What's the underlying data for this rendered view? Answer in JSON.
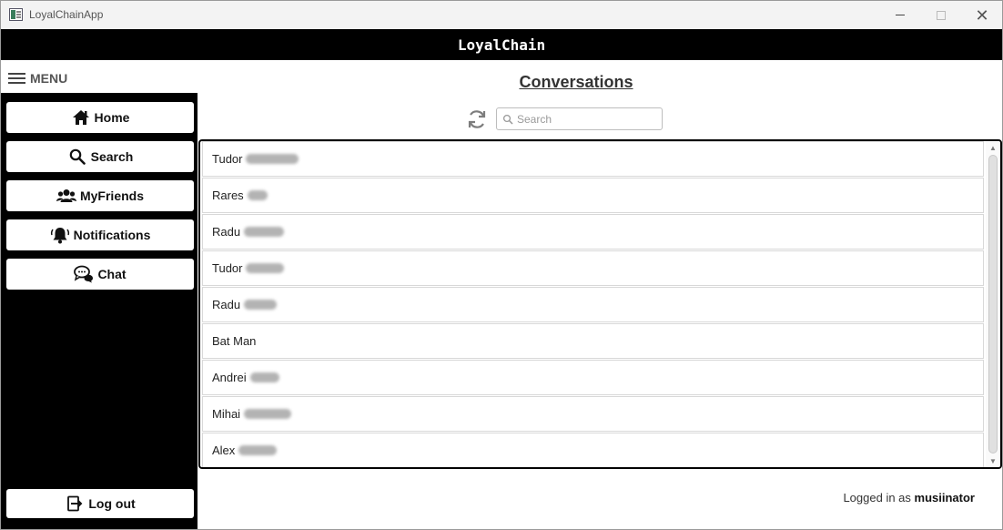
{
  "window": {
    "title": "LoyalChainApp"
  },
  "header": {
    "title": "LoyalChain"
  },
  "menu": {
    "label": "MENU"
  },
  "sidebar": {
    "items": [
      {
        "label": "Home",
        "icon": "home-icon"
      },
      {
        "label": "Search",
        "icon": "search-icon"
      },
      {
        "label": "MyFriends",
        "icon": "friends-icon"
      },
      {
        "label": "Notifications",
        "icon": "bell-icon"
      },
      {
        "label": "Chat",
        "icon": "chat-icon"
      }
    ],
    "logout_label": "Log out"
  },
  "main": {
    "title": "Conversations",
    "search_placeholder": "Search",
    "conversations": [
      {
        "first_name": "Tudor"
      },
      {
        "first_name": "Rares"
      },
      {
        "first_name": "Radu"
      },
      {
        "first_name": "Tudor"
      },
      {
        "first_name": "Radu"
      },
      {
        "first_name": "Bat Man"
      },
      {
        "first_name": "Andrei"
      },
      {
        "first_name": "Mihai"
      },
      {
        "first_name": "Alex"
      }
    ]
  },
  "footer": {
    "prefix": "Logged in as",
    "username": "musiinator"
  },
  "colors": {
    "header_bg": "#000000",
    "sidebar_bg": "#000000",
    "button_bg": "#ffffff"
  }
}
